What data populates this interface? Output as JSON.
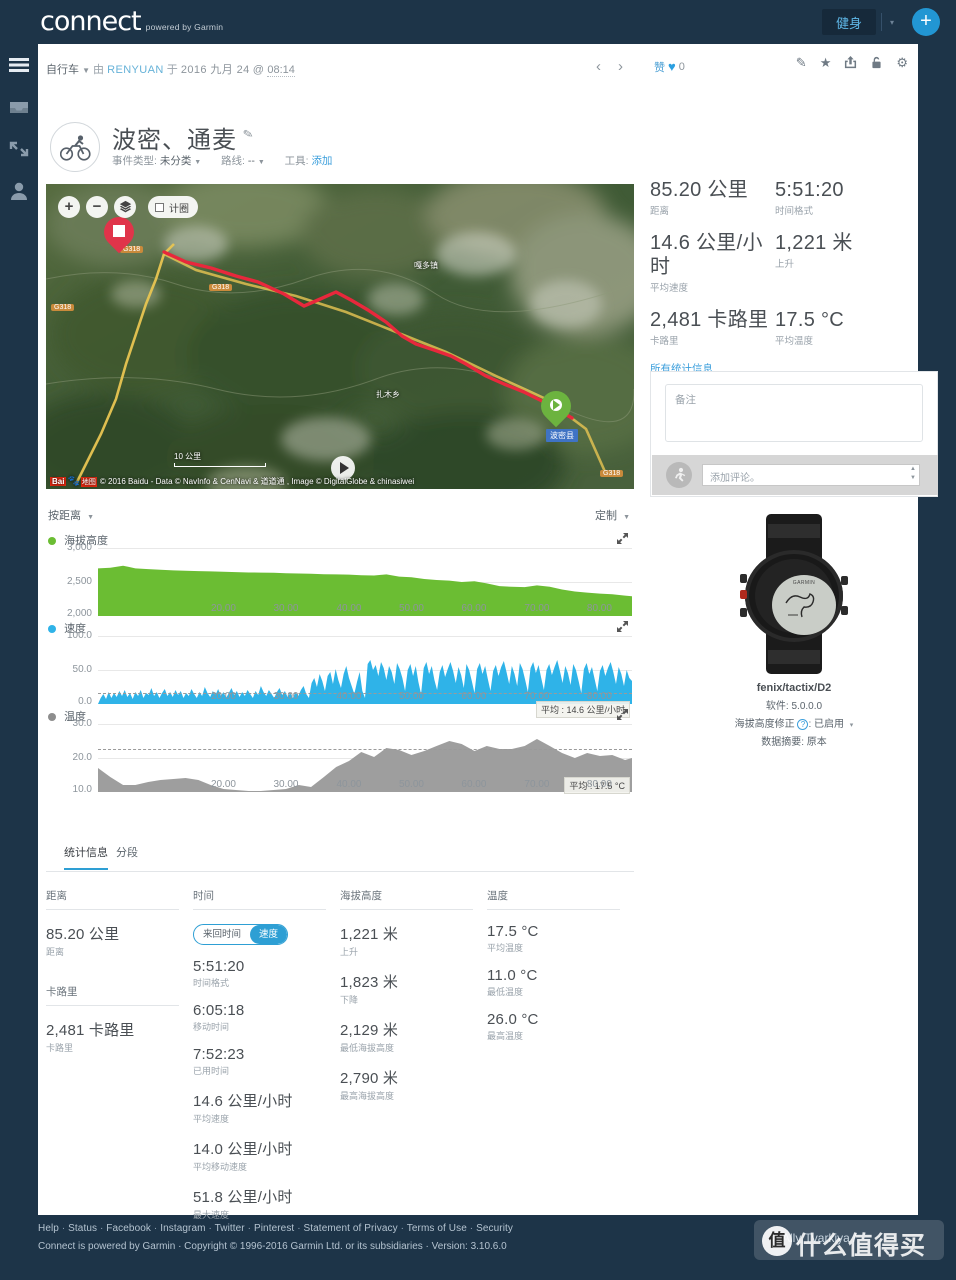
{
  "topbar": {
    "logo": "connect",
    "logo_sub": "powered by Garmin",
    "fitness_label": "健身",
    "caret": "▾",
    "plus": "+"
  },
  "rail": {
    "items": [
      {
        "name": "menu-icon"
      },
      {
        "name": "inbox-icon"
      },
      {
        "name": "connections-icon"
      },
      {
        "name": "profile-icon"
      }
    ]
  },
  "activity": {
    "sport": "自行车",
    "caret": "▼",
    "by_label": "由",
    "user": "RENYUAN",
    "on_label": "于",
    "date": "2016 九月 24",
    "at": "@",
    "time": "08:14",
    "title": "波密、通麦",
    "pen": "✎",
    "event_type_label": "事件类型:",
    "event_type_value": "未分类",
    "route_label": "路线:",
    "route_value": "--",
    "tools_label": "工具:",
    "tools_link": "添加",
    "nav_prev": "‹",
    "nav_next": "›",
    "like_word": "赞",
    "like_heart": "♥",
    "like_count": "0"
  },
  "header_tools": [
    {
      "name": "edit-icon",
      "glyph": "✎"
    },
    {
      "name": "star-icon",
      "glyph": "★"
    },
    {
      "name": "share-icon",
      "glyph": "⇱"
    },
    {
      "name": "lock-icon",
      "glyph": "⚿"
    },
    {
      "name": "gear-icon",
      "glyph": "⚙"
    }
  ],
  "map": {
    "zoom_in": "+",
    "zoom_out": "−",
    "layers_icon": "layers-icon",
    "lap_label": "计圈",
    "scale_text": "10 公里",
    "attribution": "© 2016 Baidu - Data © NavInfo & CenNavi & 道道通 , Image © DigitalGlobe & chinasiwei",
    "baidu_1": "Bai",
    "baidu_2": "地图",
    "labels": [
      {
        "text": "波密县",
        "kind": "place"
      },
      {
        "text": "嘎多镇",
        "kind": "town"
      },
      {
        "text": "扎木乡",
        "kind": "town"
      },
      {
        "text": "G318",
        "kind": "road"
      },
      {
        "text": "G318",
        "kind": "road"
      },
      {
        "text": "G318",
        "kind": "road"
      },
      {
        "text": "G318",
        "kind": "road"
      }
    ]
  },
  "summary": {
    "tiles": [
      {
        "value": "85.20 公里",
        "label": "距离"
      },
      {
        "value": "5:51:20",
        "label": "时间格式"
      },
      {
        "value": "14.6 公里/小时",
        "label": "平均速度"
      },
      {
        "value": "1,221 米",
        "label": "上升"
      },
      {
        "value": "2,481 卡路里",
        "label": "卡路里"
      },
      {
        "value": "17.5 °C",
        "label": "平均温度"
      }
    ],
    "all_stats_link": "所有统计信息"
  },
  "notes": {
    "placeholder": "备注",
    "comment_placeholder": "添加评论。"
  },
  "device": {
    "name": "fenix/tactix/D2",
    "software_label": "软件:",
    "software_value": "5.0.0.0",
    "elev_label": "海拔高度修正",
    "elev_help": "?",
    "elev_value": "已启用",
    "elev_caret": "▾",
    "summary_label": "数据摘要:",
    "summary_value": "原本",
    "watch_brand": "GARMIN"
  },
  "charts_toolbar": {
    "by_distance": "按距离",
    "customize": "定制",
    "caret": "▼"
  },
  "chart_data": [
    {
      "type": "area",
      "title": "海拔高度",
      "color": "#6bbd33",
      "xlabel": "",
      "ylabel": "",
      "ylim": [
        2000,
        3000
      ],
      "yticks": [
        2000,
        2500,
        3000
      ],
      "ytick_labels": [
        "2,000",
        "2,500",
        "3,000"
      ],
      "xlim": [
        0,
        85.2
      ],
      "xticks": [
        20,
        30,
        40,
        50,
        60,
        70,
        80
      ],
      "xtick_labels": [
        "20.00",
        "30.00",
        "40.00",
        "50.00",
        "60.00",
        "70.00",
        "80.00"
      ],
      "x": [
        0,
        2,
        4,
        6,
        8,
        10,
        12,
        14,
        16,
        18,
        20,
        22,
        24,
        26,
        28,
        30,
        32,
        34,
        36,
        38,
        40,
        42,
        44,
        46,
        48,
        50,
        52,
        54,
        56,
        58,
        60,
        62,
        64,
        66,
        68,
        70,
        72,
        74,
        76,
        78,
        80,
        82,
        84,
        85.2
      ],
      "values": [
        2700,
        2710,
        2740,
        2700,
        2690,
        2680,
        2670,
        2665,
        2660,
        2655,
        2650,
        2645,
        2640,
        2638,
        2635,
        2630,
        2625,
        2620,
        2615,
        2612,
        2608,
        2600,
        2595,
        2612,
        2580,
        2570,
        2545,
        2530,
        2520,
        2500,
        2510,
        2480,
        2440,
        2430,
        2425,
        2450,
        2430,
        2390,
        2360,
        2345,
        2330,
        2320,
        2300,
        2290
      ],
      "grid": true,
      "legend_position": "top-left"
    },
    {
      "type": "area",
      "title": "速度",
      "color": "#2fb3e8",
      "xlabel": "",
      "ylabel": "",
      "ylim": [
        0,
        100
      ],
      "yticks": [
        0,
        50,
        100
      ],
      "ytick_labels": [
        "0.0",
        "50.0",
        "100.0"
      ],
      "xlim": [
        0,
        85.2
      ],
      "xticks": [
        20,
        30,
        40,
        50,
        60,
        70,
        80
      ],
      "xtick_labels": [
        "20.00",
        "30.00",
        "40.00",
        "50.00",
        "60.00",
        "70.00",
        "80.00"
      ],
      "average": 14.6,
      "average_label": "平均 : 14.6 公里/小时",
      "grid": true,
      "legend_position": "top-left"
    },
    {
      "type": "area",
      "title": "温度",
      "color": "#9e9e9e",
      "xlabel": "",
      "ylabel": "",
      "ylim": [
        10,
        30
      ],
      "yticks": [
        10,
        20,
        30
      ],
      "ytick_labels": [
        "10.0",
        "20.0",
        "30.0"
      ],
      "xlim": [
        0,
        85.2
      ],
      "xticks": [
        20,
        30,
        40,
        50,
        60,
        70,
        80
      ],
      "xtick_labels": [
        "20.00",
        "30.00",
        "40.00",
        "50.00",
        "60.00",
        "70.00",
        "80.00"
      ],
      "average": 17.5,
      "average_label": "平均 : 17.5 °C",
      "x": [
        0,
        2,
        4,
        6,
        8,
        10,
        12,
        14,
        16,
        18,
        20,
        22,
        24,
        26,
        28,
        30,
        32,
        34,
        36,
        38,
        40,
        42,
        44,
        46,
        48,
        50,
        52,
        54,
        56,
        58,
        60,
        62,
        64,
        66,
        68,
        70,
        72,
        74,
        76,
        78,
        80,
        82,
        84,
        85.2
      ],
      "values": [
        17.0,
        14.5,
        12.5,
        12.5,
        13.0,
        13.5,
        13.8,
        14.0,
        13.5,
        12.5,
        11.5,
        11.2,
        11.0,
        11.0,
        11.2,
        11.5,
        12.5,
        12.0,
        14.5,
        17.5,
        19.5,
        22.0,
        20.5,
        23.0,
        22.5,
        21.0,
        22.0,
        23.5,
        25.0,
        24.0,
        22.0,
        23.5,
        22.5,
        22.5,
        23.5,
        25.5,
        23.5,
        21.5,
        20.0,
        21.5,
        20.5,
        21.0,
        19.5,
        20.0
      ],
      "grid": true,
      "legend_position": "top-left"
    }
  ],
  "stats": {
    "tabs": [
      {
        "label": "统计信息",
        "active": true
      },
      {
        "label": "分段",
        "active": false
      }
    ],
    "columns": [
      {
        "header": "距离",
        "header2": "卡路里",
        "items": [
          {
            "value": "85.20 公里",
            "label": "距离"
          }
        ],
        "items2": [
          {
            "value": "2,481 卡路里",
            "label": "卡路里"
          }
        ]
      },
      {
        "header": "时间",
        "toggle": {
          "left": "来回时间",
          "right": "速度",
          "active": "right"
        },
        "items": [
          {
            "value": "5:51:20",
            "label": "时间格式"
          },
          {
            "value": "6:05:18",
            "label": "移动时间"
          },
          {
            "value": "7:52:23",
            "label": "已用时间"
          },
          {
            "value": "14.6 公里/小时",
            "label": "平均速度"
          },
          {
            "value": "14.0 公里/小时",
            "label": "平均移动速度"
          },
          {
            "value": "51.8 公里/小时",
            "label": "最大速度"
          }
        ]
      },
      {
        "header": "海拔高度",
        "items": [
          {
            "value": "1,221 米",
            "label": "上升"
          },
          {
            "value": "1,823 米",
            "label": "下降"
          },
          {
            "value": "2,129 米",
            "label": "最低海拔高度"
          },
          {
            "value": "2,790 米",
            "label": "最高海拔高度"
          }
        ]
      },
      {
        "header": "温度",
        "items": [
          {
            "value": "17.5 °C",
            "label": "平均温度"
          },
          {
            "value": "11.0 °C",
            "label": "最低温度"
          },
          {
            "value": "26.0 °C",
            "label": "最高温度"
          }
        ]
      }
    ]
  },
  "footer": {
    "links": [
      "Help",
      "Status",
      "Facebook",
      "Instagram",
      "Twitter",
      "Pinterest",
      "Statement of Privacy",
      "Terms of Use",
      "Security"
    ],
    "copyright": "Connect is powered by Garmin · Copyright © 1996-2016 Garmin Ltd. or its subsidiaries · Version: 3.10.6.0"
  },
  "watermark": {
    "en": "A Ally Tvarkiya /",
    "cn": "什么值得买",
    "badge": "值"
  }
}
